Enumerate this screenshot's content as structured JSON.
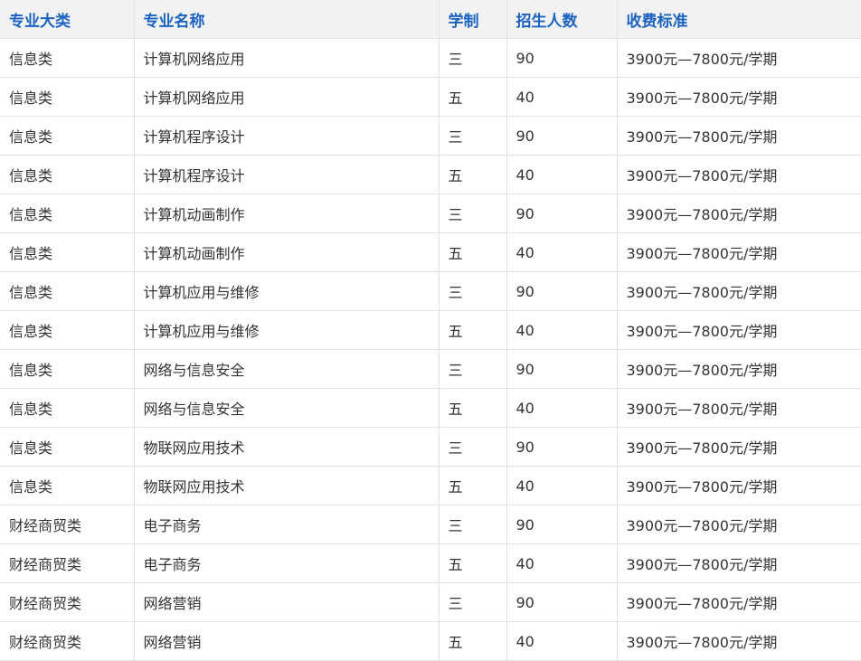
{
  "table": {
    "headers": [
      "专业大类",
      "专业名称",
      "学制",
      "招生人数",
      "收费标准"
    ],
    "rows": [
      [
        "信息类",
        "计算机网络应用",
        "三",
        "90",
        "3900元—7800元/学期"
      ],
      [
        "信息类",
        "计算机网络应用",
        "五",
        "40",
        "3900元—7800元/学期"
      ],
      [
        "信息类",
        "计算机程序设计",
        "三",
        "90",
        "3900元—7800元/学期"
      ],
      [
        "信息类",
        "计算机程序设计",
        "五",
        "40",
        "3900元—7800元/学期"
      ],
      [
        "信息类",
        "计算机动画制作",
        "三",
        "90",
        "3900元—7800元/学期"
      ],
      [
        "信息类",
        "计算机动画制作",
        "五",
        "40",
        "3900元—7800元/学期"
      ],
      [
        "信息类",
        "计算机应用与维修",
        "三",
        "90",
        "3900元—7800元/学期"
      ],
      [
        "信息类",
        "计算机应用与维修",
        "五",
        "40",
        "3900元—7800元/学期"
      ],
      [
        "信息类",
        "网络与信息安全",
        "三",
        "90",
        "3900元—7800元/学期"
      ],
      [
        "信息类",
        "网络与信息安全",
        "五",
        "40",
        "3900元—7800元/学期"
      ],
      [
        "信息类",
        "物联网应用技术",
        "三",
        "90",
        "3900元—7800元/学期"
      ],
      [
        "信息类",
        "物联网应用技术",
        "五",
        "40",
        "3900元—7800元/学期"
      ],
      [
        "财经商贸类",
        "电子商务",
        "三",
        "90",
        "3900元—7800元/学期"
      ],
      [
        "财经商贸类",
        "电子商务",
        "五",
        "40",
        "3900元—7800元/学期"
      ],
      [
        "财经商贸类",
        "网络营销",
        "三",
        "90",
        "3900元—7800元/学期"
      ],
      [
        "财经商贸类",
        "网络营销",
        "五",
        "40",
        "3900元—7800元/学期"
      ]
    ]
  },
  "colors": {
    "header_text": "#1a63c2",
    "header_bg": "#f2f2f2",
    "body_text": "#333333",
    "border": "#e2e2e2"
  }
}
